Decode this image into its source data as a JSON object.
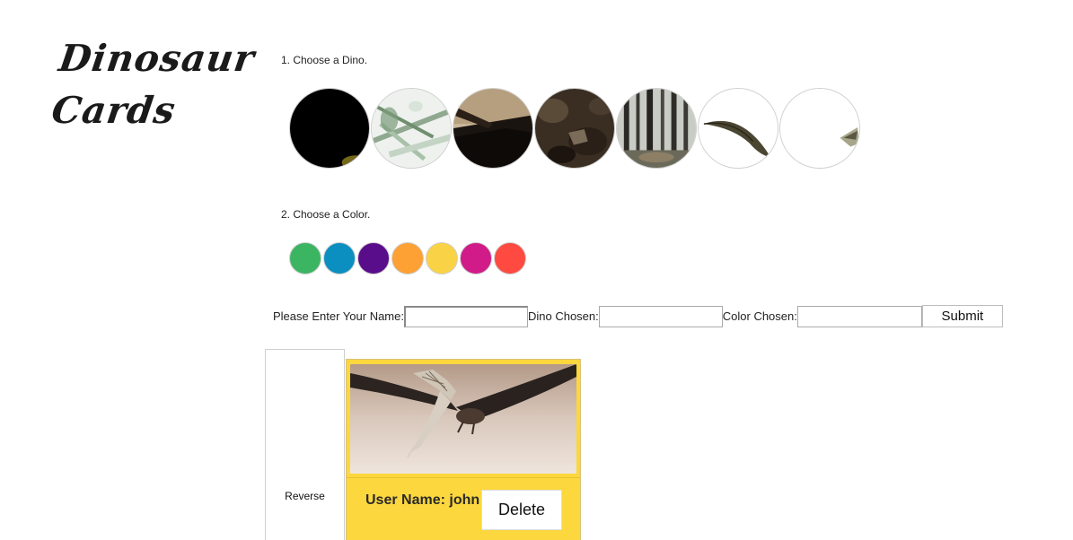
{
  "logo": {
    "line1": "Dinosaur",
    "line2": "Cards"
  },
  "steps": {
    "choose_dino": "1. Choose a Dino.",
    "choose_color": "2. Choose a Color."
  },
  "dinos": [
    {
      "name": "dino-option-1",
      "icon": "dark-dinosaur-thumbnail"
    },
    {
      "name": "dino-option-2",
      "icon": "fern-dinosaur-thumbnail"
    },
    {
      "name": "dino-option-3",
      "icon": "wing-dinosaur-thumbnail"
    },
    {
      "name": "dino-option-4",
      "icon": "rock-dinosaur-thumbnail"
    },
    {
      "name": "dino-option-5",
      "icon": "forest-dinosaur-thumbnail"
    },
    {
      "name": "dino-option-6",
      "icon": "beak-dinosaur-thumbnail"
    },
    {
      "name": "dino-option-7",
      "icon": "beak-tip-dinosaur-thumbnail"
    }
  ],
  "colors": [
    "#3cb562",
    "#0b8fc0",
    "#5a0d8a",
    "#fda135",
    "#fad245",
    "#d01b88",
    "#fe4a40"
  ],
  "form": {
    "name_label": "Please Enter Your Name:",
    "name_value": "",
    "dino_label": "Dino Chosen:",
    "dino_value": "",
    "color_label": "Color Chosen:",
    "color_value": "",
    "submit_label": "Submit"
  },
  "reverse_label": "Reverse",
  "card": {
    "background": "#fcd73d",
    "image_icon": "pterodactyl-photo",
    "user_name": "User Name: john",
    "delete_label": "Delete"
  }
}
